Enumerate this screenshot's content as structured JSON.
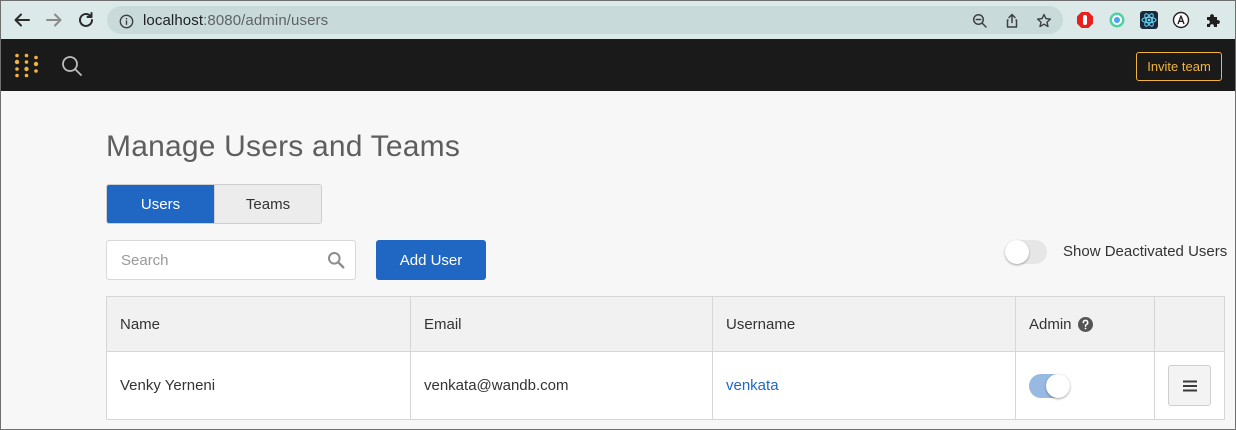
{
  "browser": {
    "url_host": "localhost",
    "url_rest": ":8080/admin/users"
  },
  "header": {
    "invite_label": "Invite team",
    "accent_color": "#f2b43d"
  },
  "page": {
    "title": "Manage Users and Teams",
    "tabs": [
      {
        "label": "Users",
        "active": true
      },
      {
        "label": "Teams",
        "active": false
      }
    ],
    "search_placeholder": "Search",
    "add_user_label": "Add User",
    "show_deactivated_label": "Show Deactivated Users",
    "show_deactivated_on": false,
    "primary_color": "#2067c4"
  },
  "table": {
    "columns": [
      "Name",
      "Email",
      "Username",
      "Admin",
      ""
    ],
    "rows": [
      {
        "name": "Venky Yerneni",
        "email": "venkata@wandb.com",
        "username": "venkata",
        "admin": true
      }
    ]
  }
}
